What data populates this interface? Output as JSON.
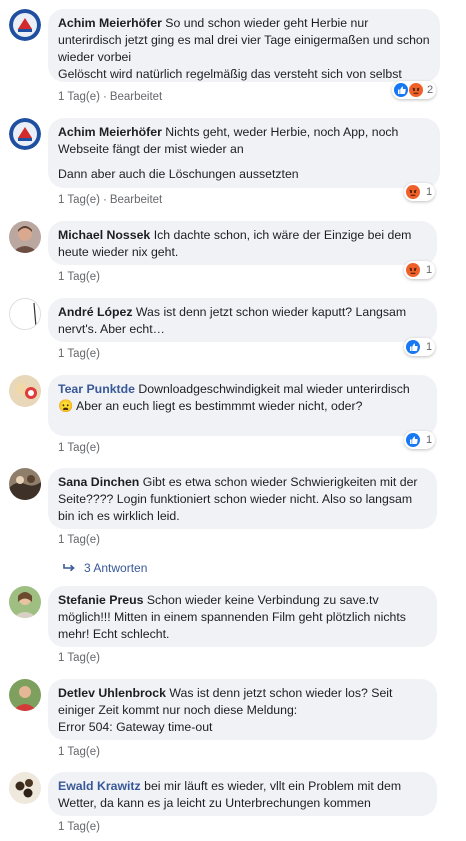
{
  "comments": [
    {
      "author": "Achim Meierhöfer",
      "text": "So und schon wieder geht Herbie nur unterirdisch jetzt ging es mal drei vier Tage einigermaßen und schon wieder vorbei\nGelöscht wird natürlich regelmäßig das versteht sich von selbst",
      "time": "1 Tag(e)",
      "edited": "Bearbeitet",
      "reaction_icons": [
        "like-icon",
        "angry-icon"
      ],
      "reaction_count": "2"
    },
    {
      "author": "Achim Meierhöfer",
      "text": "Nichts geht, weder Herbie, noch App, noch Webseite fängt der mist wieder an",
      "text2": "Dann aber auch die Löschungen aussetzten",
      "time": "1 Tag(e)",
      "edited": "Bearbeitet",
      "reaction_icons": [
        "angry-icon"
      ],
      "reaction_count": "1"
    },
    {
      "author": "Michael Nossek",
      "text": "Ich dachte schon, ich wäre der Einzige bei dem heute wieder nix geht.",
      "time": "1 Tag(e)",
      "reaction_icons": [
        "angry-icon"
      ],
      "reaction_count": "1"
    },
    {
      "author": "André López",
      "text": "Was ist denn jetzt schon wieder kaputt? Langsam nervt's. Aber echt…",
      "time": "1 Tag(e)",
      "reaction_icons": [
        "like-icon"
      ],
      "reaction_count": "1"
    },
    {
      "author": "Tear Punktde",
      "text": "Downloadgeschwindigkeit mal wieder unterirdisch 😦 Aber an euch liegt es bestimmmt wieder nicht, oder?",
      "time": "1 Tag(e)",
      "reaction_icons": [
        "like-icon"
      ],
      "reaction_count": "1"
    },
    {
      "author": "Sana Dinchen",
      "text": "Gibt es etwa schon wieder Schwierigkeiten mit der Seite???? Login funktioniert schon wieder nicht. Also so langsam bin ich es wirklich leid.",
      "time": "1 Tag(e)",
      "replies_label": "3 Antworten"
    },
    {
      "author": "Stefanie Preus",
      "text": "Schon wieder keine Verbindung zu save.tv möglich!!! Mitten in einem spannenden Film geht plötzlich nichts mehr! Echt schlecht.",
      "time": "1 Tag(e)"
    },
    {
      "author": "Detlev Uhlenbrock",
      "text": "Was ist denn jetzt schon wieder los? Seit einiger Zeit kommt nur noch diese Meldung:\nError 504: Gateway time-out",
      "time": "1 Tag(e)"
    },
    {
      "author": "Ewald Krawitz",
      "text": "bei mir läuft es wieder, vllt ein Problem mit dem Wetter, da kann es ja leicht zu Unterbrechungen kommen",
      "time": "1 Tag(e)"
    }
  ],
  "colors": {
    "bubble": "#f0f2f5",
    "link_author": "#385898",
    "meta": "#65676b",
    "like": "#1877f2",
    "angry": "#f0612a"
  }
}
